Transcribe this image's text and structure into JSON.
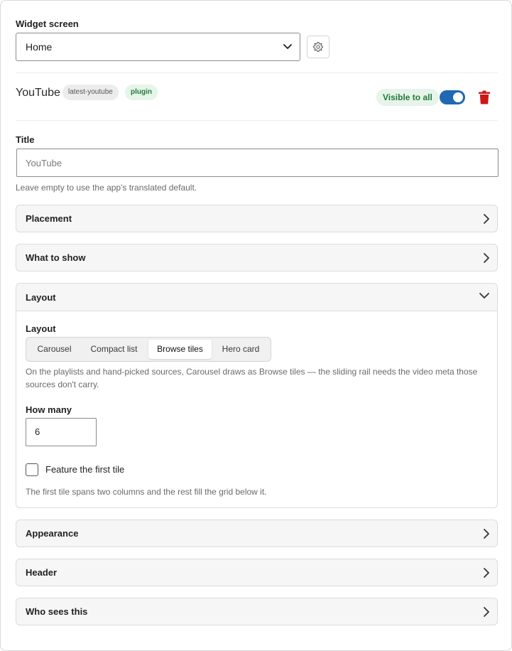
{
  "widget_screen": {
    "label": "Widget screen",
    "selected": "Home"
  },
  "widget": {
    "name": "YouTube",
    "tags": [
      "latest-youtube",
      "plugin"
    ],
    "visibility": "Visible to all",
    "enabled": true
  },
  "title_field": {
    "label": "Title",
    "placeholder": "YouTube",
    "value": "",
    "help": "Leave empty to use the app's translated default."
  },
  "panels": {
    "placement": "Placement",
    "what_to_show": "What to show",
    "layout": "Layout",
    "appearance": "Appearance",
    "header": "Header",
    "who_sees_this": "Who sees this"
  },
  "layout_section": {
    "layout_label": "Layout",
    "options": [
      "Carousel",
      "Compact list",
      "Browse tiles",
      "Hero card"
    ],
    "selected": "Browse tiles",
    "layout_help_1": "On the playlists and hand-picked sources, Carousel draws as Browse tiles — the sliding rail needs the video meta those",
    "layout_help_2": "sources don't carry.",
    "how_many_label": "How many",
    "how_many_value": "6",
    "feature_first_label": "Feature the first tile",
    "feature_first_checked": false,
    "feature_help": "The first tile spans two columns and the rest fill the grid below it."
  },
  "colors": {
    "accent": "#1f68b3",
    "success_text": "#217a38",
    "success_bg": "#e6f4e9",
    "danger": "#cc1818"
  }
}
